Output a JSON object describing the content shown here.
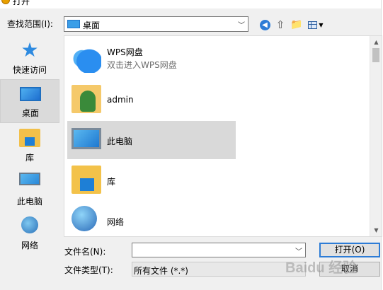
{
  "window": {
    "title": "打开"
  },
  "toolbar": {
    "look_in_label": "查找范围(I):",
    "look_in_value": "桌面",
    "back_icon": "back-arrow-icon",
    "up_icon": "up-folder-icon",
    "new_folder_icon": "new-folder-icon",
    "views_icon": "view-menu-icon"
  },
  "places": [
    {
      "label": "快速访问",
      "icon": "star-icon"
    },
    {
      "label": "桌面",
      "icon": "desktop-icon"
    },
    {
      "label": "库",
      "icon": "library-icon"
    },
    {
      "label": "此电脑",
      "icon": "computer-icon"
    },
    {
      "label": "网络",
      "icon": "network-icon"
    }
  ],
  "files": [
    {
      "name": "WPS网盘",
      "subtitle": "双击进入WPS网盘",
      "icon": "cloud-icon"
    },
    {
      "name": "admin",
      "icon": "user-folder-icon"
    },
    {
      "name": "此电脑",
      "icon": "computer-icon"
    },
    {
      "name": "库",
      "icon": "library-icon"
    },
    {
      "name": "网络",
      "icon": "network-icon"
    }
  ],
  "form": {
    "filename_label": "文件名(N):",
    "filename_value": "",
    "filetype_label": "文件类型(T):",
    "filetype_value": "所有文件 (*.*)",
    "open_label": "打开(O)",
    "cancel_label": "取消"
  },
  "watermark": "Baidu 经验",
  "colors": {
    "accent": "#2d7cd6",
    "selection": "#d9d9d9"
  }
}
